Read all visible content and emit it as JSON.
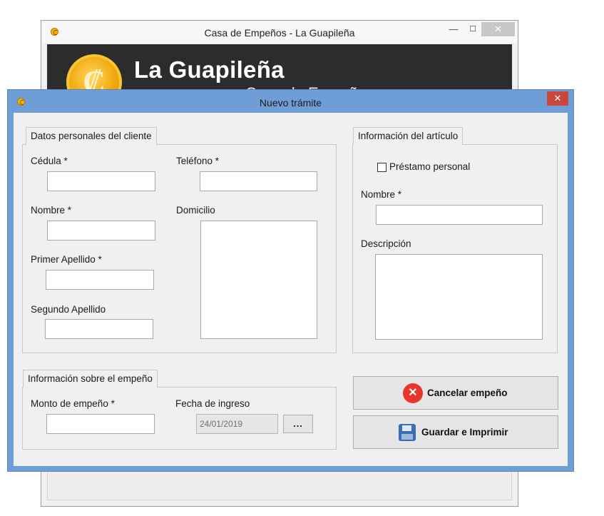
{
  "background_window": {
    "title": "Casa de Empeños - La Guapileña",
    "controls": {
      "minimize": "—",
      "maximize": "☐",
      "close": "✕"
    },
    "banner": {
      "logo_symbol": "₡",
      "title": "La Guapileña",
      "subtitle_partial": "Casa de Empeños"
    }
  },
  "dialog": {
    "title": "Nuevo trámite",
    "close": "✕",
    "client_group": {
      "title": "Datos personales del cliente",
      "cedula_label": "Cédula *",
      "cedula_value": "",
      "telefono_label": "Teléfono *",
      "telefono_value": "",
      "nombre_label": "Nombre *",
      "nombre_value": "",
      "domicilio_label": "Domicilio",
      "domicilio_value": "",
      "primer_apellido_label": "Primer Apellido *",
      "primer_apellido_value": "",
      "segundo_apellido_label": "Segundo Apellido",
      "segundo_apellido_value": ""
    },
    "article_group": {
      "title": "Información del artículo",
      "personal_loan_label": "Préstamo personal",
      "personal_loan_checked": false,
      "nombre_label": "Nombre *",
      "nombre_value": "",
      "descripcion_label": "Descripción",
      "descripcion_value": ""
    },
    "pawn_group": {
      "title": "Información sobre el empeño",
      "monto_label": "Monto de empeño *",
      "monto_value": "",
      "fecha_label": "Fecha de ingreso",
      "fecha_value": "24/01/2019",
      "date_picker_button": "..."
    },
    "actions": {
      "cancel_label": "Cancelar empeño",
      "save_label": "Guardar e Imprimir"
    }
  },
  "colors": {
    "dialog_frame": "#6f9ed6",
    "cancel_icon": "#e8342b",
    "save_icon": "#3b6db5",
    "banner_bg": "#2c2c2c",
    "coin": "#f2aa10"
  }
}
